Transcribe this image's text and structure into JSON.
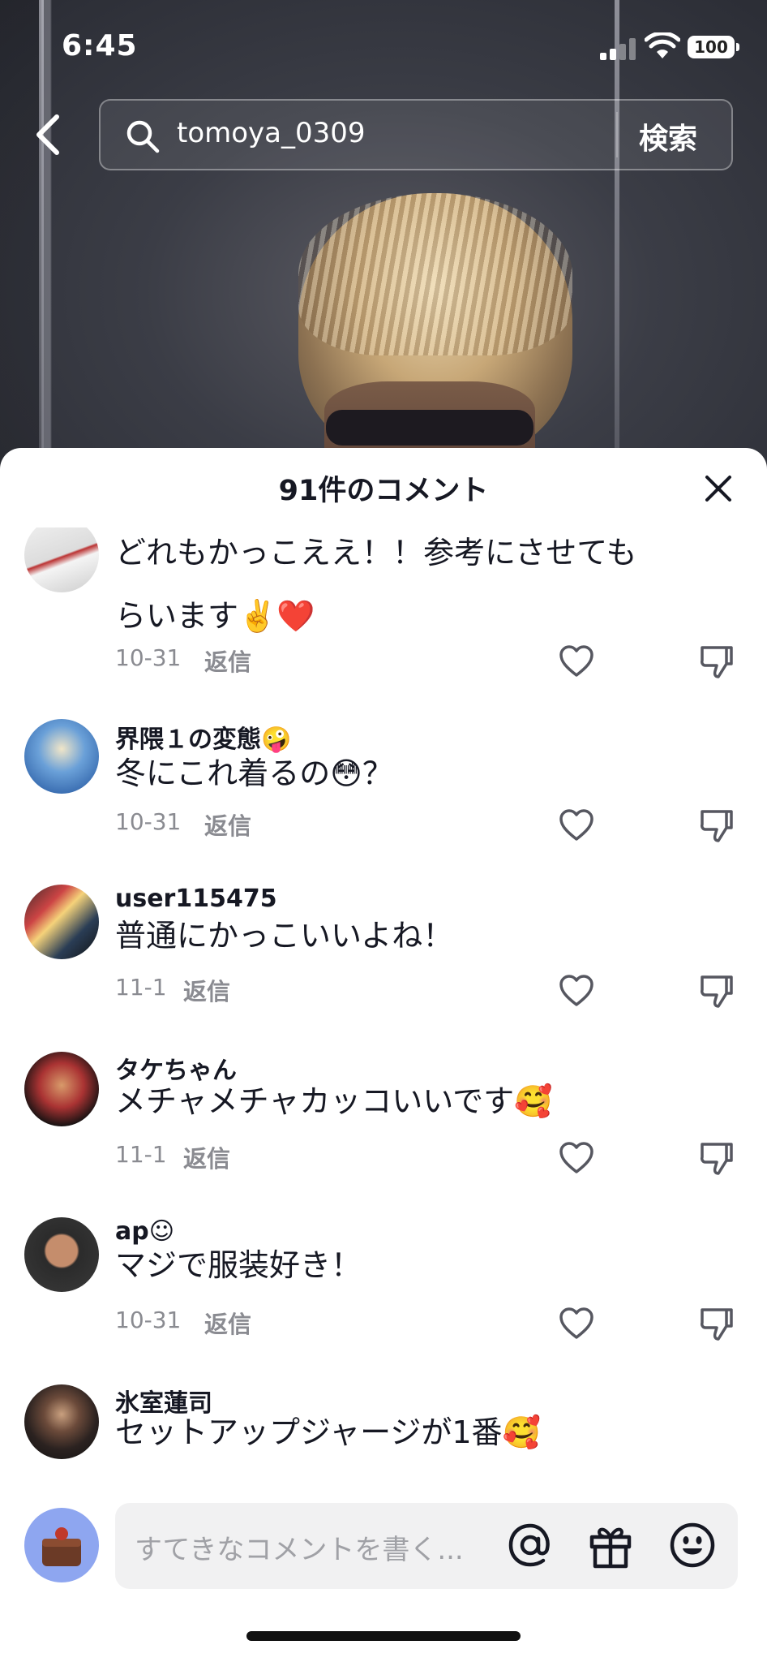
{
  "status_bar": {
    "time": "6:45",
    "battery": "100"
  },
  "search": {
    "query": "tomoya_0309",
    "submit_label": "検索"
  },
  "comments_sheet": {
    "title": "91件のコメント",
    "comments": [
      {
        "user": "",
        "text": "どれもかっこええ！！参考にさせてもらいます✌️❤️",
        "date": "10-31",
        "reply_label": "返信"
      },
      {
        "user": "界隈１の変態🤪",
        "text": "冬にこれ着るの😳？",
        "date": "10-31",
        "reply_label": "返信"
      },
      {
        "user": "user115475",
        "text": "普通にかっこいいよね！",
        "date": "11-1",
        "reply_label": "返信"
      },
      {
        "user": "タケちゃん",
        "text": "メチャメチャカッコいいです🥰",
        "date": "11-1",
        "reply_label": "返信"
      },
      {
        "user": "ap☺",
        "text": "マジで服装好き！",
        "date": "10-31",
        "reply_label": "返信"
      },
      {
        "user": "氷室蓮司",
        "text": "セットアップジャージが1番🥰",
        "date": "",
        "reply_label": ""
      }
    ]
  },
  "composer": {
    "placeholder": "すてきなコメントを書く..."
  }
}
